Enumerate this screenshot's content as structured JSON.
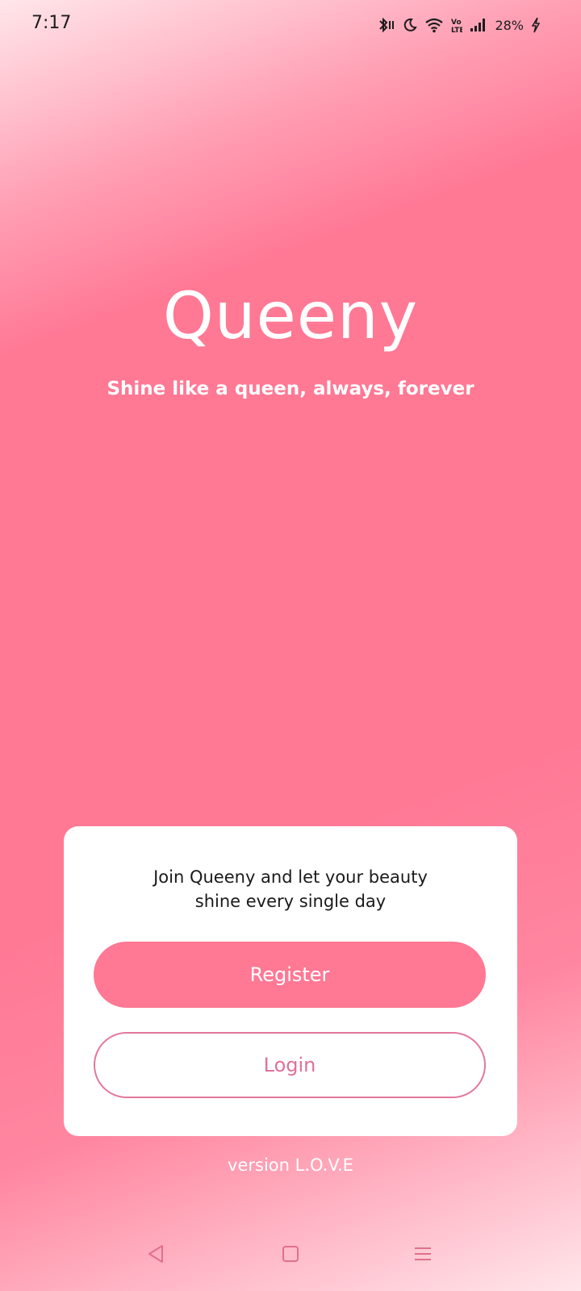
{
  "status_bar": {
    "time": "7:17",
    "battery": "28%",
    "icons": [
      "bluetooth-icon",
      "moon-icon",
      "wifi-icon",
      "volte-icon",
      "signal-icon",
      "charging-icon"
    ]
  },
  "app": {
    "title": "Queeny",
    "tagline": "Shine like a queen, always, forever"
  },
  "card": {
    "message_line1": "Join Queeny and let your beauty",
    "message_line2": "shine every single day",
    "register_label": "Register",
    "login_label": "Login"
  },
  "footer": {
    "version": "version L.O.V.E"
  },
  "nav_bar": {
    "icons": [
      "back-icon",
      "home-icon",
      "menu-icon"
    ]
  },
  "colors": {
    "accent": "#ff7894",
    "login_border": "#e2789a",
    "login_text": "#e0709a"
  }
}
